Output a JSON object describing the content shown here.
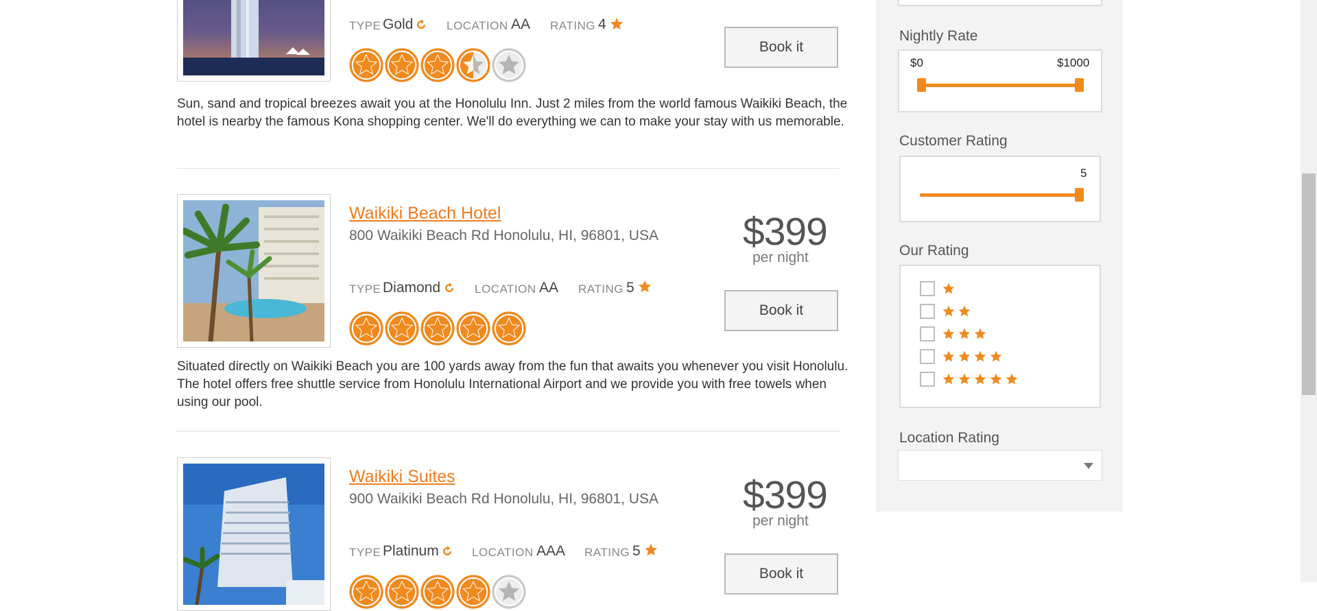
{
  "hotels": [
    {
      "name": "",
      "address": "",
      "price": "",
      "per_night": "",
      "type_label": "TYPE",
      "type_value": "Gold",
      "location_label": "LOCATION",
      "location_value": "AA",
      "rating_label": "RATING",
      "rating_value": "4",
      "star_rating": 3.5,
      "book_label": "Book it",
      "description": "Sun, sand and tropical breezes await you at the Honolulu Inn. Just 2 miles from the world famous Waikiki Beach, the hotel is nearby the famous Kona shopping center. We'll do everything we can to make your stay with us memorable."
    },
    {
      "name": "Waikiki Beach Hotel",
      "address": "800 Waikiki Beach Rd Honolulu, HI, 96801, USA",
      "price": "$399",
      "per_night": "per night",
      "type_label": "TYPE",
      "type_value": "Diamond",
      "location_label": "LOCATION",
      "location_value": "AA",
      "rating_label": "RATING",
      "rating_value": "5",
      "star_rating": 5,
      "book_label": "Book it",
      "description": "Situated directly on Waikiki Beach you are 100 yards away from the fun that awaits you whenever you visit Honolulu. The hotel offers free shuttle service from Honolulu International Airport and we provide you with free towels when using our pool."
    },
    {
      "name": "Waikiki Suites",
      "address": "900 Waikiki Beach Rd Honolulu, HI, 96801, USA",
      "price": "$399",
      "per_night": "per night",
      "type_label": "TYPE",
      "type_value": "Platinum",
      "location_label": "LOCATION",
      "location_value": "AAA",
      "rating_label": "RATING",
      "rating_value": "5",
      "star_rating": 4,
      "book_label": "Book it",
      "description": ""
    }
  ],
  "sidebar": {
    "nightly_rate": {
      "label": "Nightly Rate",
      "min_text": "$0",
      "max_text": "$1000",
      "min_value": 0,
      "max_value": 1000
    },
    "customer_rating": {
      "label": "Customer Rating",
      "value_text": "5",
      "value": 5
    },
    "our_rating": {
      "label": "Our Rating",
      "options": [
        1,
        2,
        3,
        4,
        5
      ]
    },
    "location_rating": {
      "label": "Location Rating",
      "selected": ""
    }
  },
  "colors": {
    "accent": "#f08a1e",
    "link": "#f07c1e"
  },
  "icons": {
    "refresh": "refresh-icon",
    "star": "star-icon",
    "dropdown": "chevron-down-icon"
  }
}
